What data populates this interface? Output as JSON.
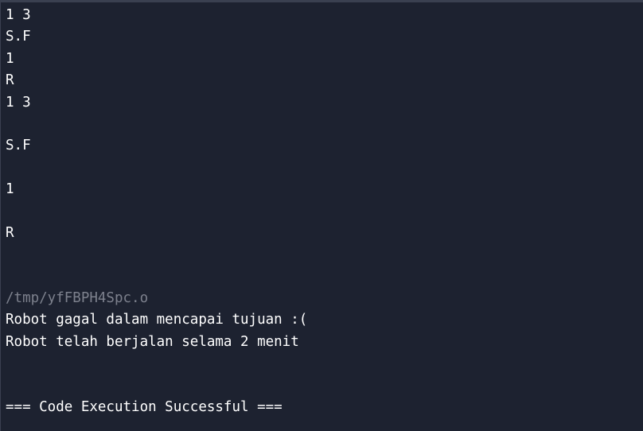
{
  "terminal": {
    "lines": [
      {
        "text": "1 3",
        "style": "normal"
      },
      {
        "text": "S.F",
        "style": "normal"
      },
      {
        "text": "1",
        "style": "normal"
      },
      {
        "text": "R",
        "style": "normal"
      },
      {
        "text": "1 3",
        "style": "normal"
      },
      {
        "text": "",
        "style": "normal"
      },
      {
        "text": "S.F",
        "style": "normal"
      },
      {
        "text": "",
        "style": "normal"
      },
      {
        "text": "1",
        "style": "normal"
      },
      {
        "text": "",
        "style": "normal"
      },
      {
        "text": "R",
        "style": "normal"
      },
      {
        "text": "",
        "style": "normal"
      },
      {
        "text": "",
        "style": "normal"
      },
      {
        "text": "/tmp/yfFBPH4Spc.o",
        "style": "muted"
      },
      {
        "text": "Robot gagal dalam mencapai tujuan :(",
        "style": "normal"
      },
      {
        "text": "Robot telah berjalan selama 2 menit",
        "style": "normal"
      },
      {
        "text": "",
        "style": "normal"
      },
      {
        "text": "",
        "style": "normal"
      },
      {
        "text": "=== Code Execution Successful ===",
        "style": "normal"
      }
    ]
  },
  "colors": {
    "background": "#1d2230",
    "text": "#ffffff",
    "muted_text": "#7d818d",
    "border": "#3a4050"
  }
}
